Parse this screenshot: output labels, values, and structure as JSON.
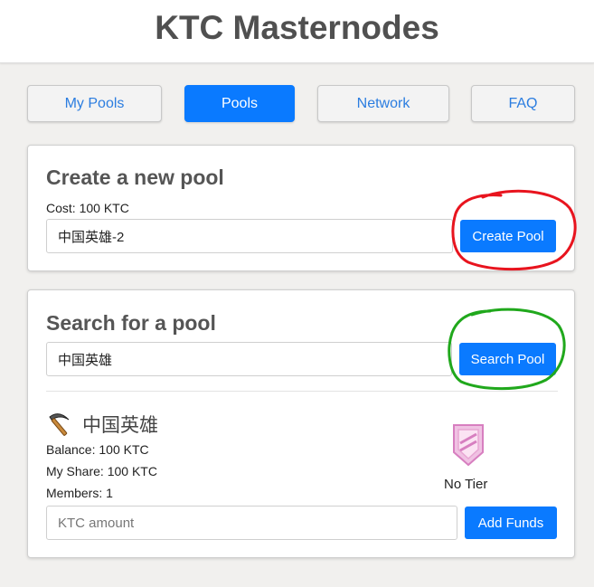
{
  "header": {
    "title": "KTC Masternodes"
  },
  "nav": {
    "my_pools": "My Pools",
    "pools": "Pools",
    "network": "Network",
    "faq": "FAQ"
  },
  "create_pool": {
    "title": "Create a new pool",
    "cost": "Cost: 100 KTC",
    "input_value": "中国英雄-2",
    "button": "Create Pool"
  },
  "search_pool": {
    "title": "Search for a pool",
    "input_value": "中国英雄",
    "button": "Search Pool"
  },
  "result": {
    "icon": "pickaxe-icon",
    "name": "中国英雄",
    "balance": "Balance: 100 KTC",
    "my_share": "My Share: 100 KTC",
    "members": "Members: 1",
    "tier_icon": "shield-badge-icon",
    "tier": "No Tier",
    "amount_placeholder": "KTC amount",
    "add_funds": "Add Funds"
  },
  "colors": {
    "accent": "#0a7aff",
    "annotation_red": "#e8141e",
    "annotation_green": "#20a81c",
    "badge_pink": "#e7a6d3"
  }
}
